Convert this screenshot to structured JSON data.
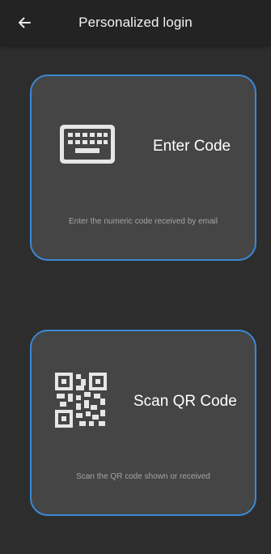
{
  "app_bar": {
    "title": "Personalized login",
    "back_icon": "arrow-left-icon"
  },
  "options": [
    {
      "title": "Enter Code",
      "description": "Enter the numeric code received by email",
      "icon": "keyboard-icon"
    },
    {
      "title": "Scan QR Code",
      "description": "Scan the QR code shown or received",
      "icon": "qr-code-icon"
    }
  ],
  "colors": {
    "background": "#2d2d2d",
    "app_bar": "#232323",
    "card": "#454545",
    "card_border": "#3c88d6",
    "text_primary": "#ffffff",
    "text_secondary": "#a5a5a5"
  }
}
